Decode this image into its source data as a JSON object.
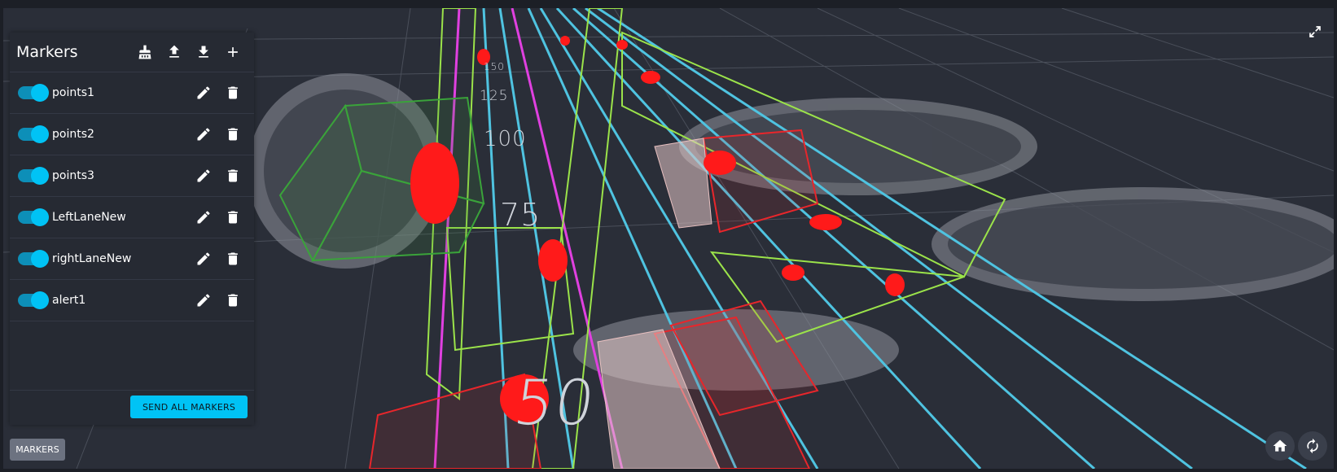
{
  "scene": {
    "distance_labels": [
      "50",
      "75",
      "100",
      "125",
      "150"
    ]
  },
  "panel": {
    "title": "Markers",
    "header_icons": [
      "broom-icon",
      "upload-icon",
      "download-icon",
      "add-icon"
    ],
    "items": [
      {
        "label": "points1",
        "enabled": true
      },
      {
        "label": "points2",
        "enabled": true
      },
      {
        "label": "points3",
        "enabled": true
      },
      {
        "label": "LeftLaneNew",
        "enabled": true
      },
      {
        "label": "rightLaneNew",
        "enabled": true
      },
      {
        "label": "alert1",
        "enabled": true
      }
    ],
    "send_all_label": "SEND ALL MARKERS"
  },
  "markers_button_label": "MARKERS",
  "colors": {
    "accent": "#00c3f5",
    "lane_cyan": "#4fc3e0",
    "lane_magenta": "#e040e0",
    "box_green": "#9be34a",
    "box_red": "#e8262b",
    "points_red": "#ff1a1a"
  }
}
